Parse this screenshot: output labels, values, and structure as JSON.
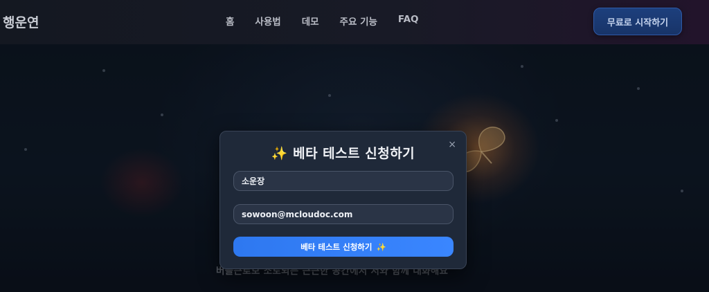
{
  "header": {
    "logo": "행운연",
    "nav": [
      "홈",
      "사용법",
      "데모",
      "주요 기능",
      "FAQ"
    ],
    "cta_label": "무료로 시작하기"
  },
  "hero": {
    "subtitle": "버블큰로보 소토되는 근근한 공간에서 서와 함께 대화해요"
  },
  "modal": {
    "title_icon": "✨",
    "title": "베타 테스트 신청하기",
    "close_icon": "×",
    "name_value": "소운장",
    "email_value": "sowoon@mcloudoc.com",
    "submit_label": "베타 테스트 신청하기",
    "submit_icon": "✨"
  },
  "colors": {
    "accent": "#3a86ff",
    "cta_bg": "#1d3f7d",
    "modal_bg": "#1f2939"
  }
}
